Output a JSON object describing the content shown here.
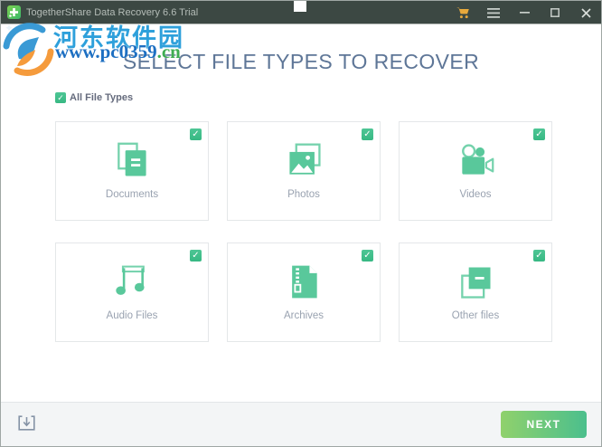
{
  "window": {
    "title": "TogetherShare Data Recovery 6.6 Trial",
    "app_icon": "togethershare-logo-icon",
    "controls": {
      "cart": "cart-icon",
      "menu": "hamburger-menu-icon",
      "minimize": "minimize-icon",
      "maximize": "maximize-icon",
      "close": "close-icon"
    }
  },
  "watermark": {
    "logo": "pc0359-logo-icon",
    "site_name": "河东软件园",
    "url_main": "www.pc0359",
    "url_tld": ".cn"
  },
  "main": {
    "heading": "SELECT FILE TYPES TO RECOVER",
    "check_glyph": "✓",
    "all_file_types": {
      "label": "All File Types",
      "checked": true
    },
    "file_types": [
      {
        "label": "Documents",
        "icon": "documents-icon",
        "checked": true
      },
      {
        "label": "Photos",
        "icon": "photos-icon",
        "checked": true
      },
      {
        "label": "Videos",
        "icon": "videos-icon",
        "checked": true
      },
      {
        "label": "Audio Files",
        "icon": "audio-files-icon",
        "checked": true
      },
      {
        "label": "Archives",
        "icon": "archives-icon",
        "checked": true
      },
      {
        "label": "Other files",
        "icon": "other-files-icon",
        "checked": true
      }
    ]
  },
  "footer": {
    "download_icon": "download-icon",
    "next_label": "NEXT"
  },
  "colors": {
    "titlebar_bg": "#3C4843",
    "accent_green": "#59C89B",
    "checkbox_green": "#41BF8B",
    "next_gradient_start": "#90D16C",
    "next_gradient_end": "#4BBF8D",
    "cart_orange": "#E8A93C",
    "heading_text": "#5E7697",
    "card_label_text": "#99A2B0",
    "watermark_blue": "#2EA0DB",
    "watermark_red": "#B23A2A",
    "watermark_url_blue": "#1D6FC2",
    "watermark_green": "#3FAD52",
    "watermark_logo_orange": "#F59B3C"
  }
}
